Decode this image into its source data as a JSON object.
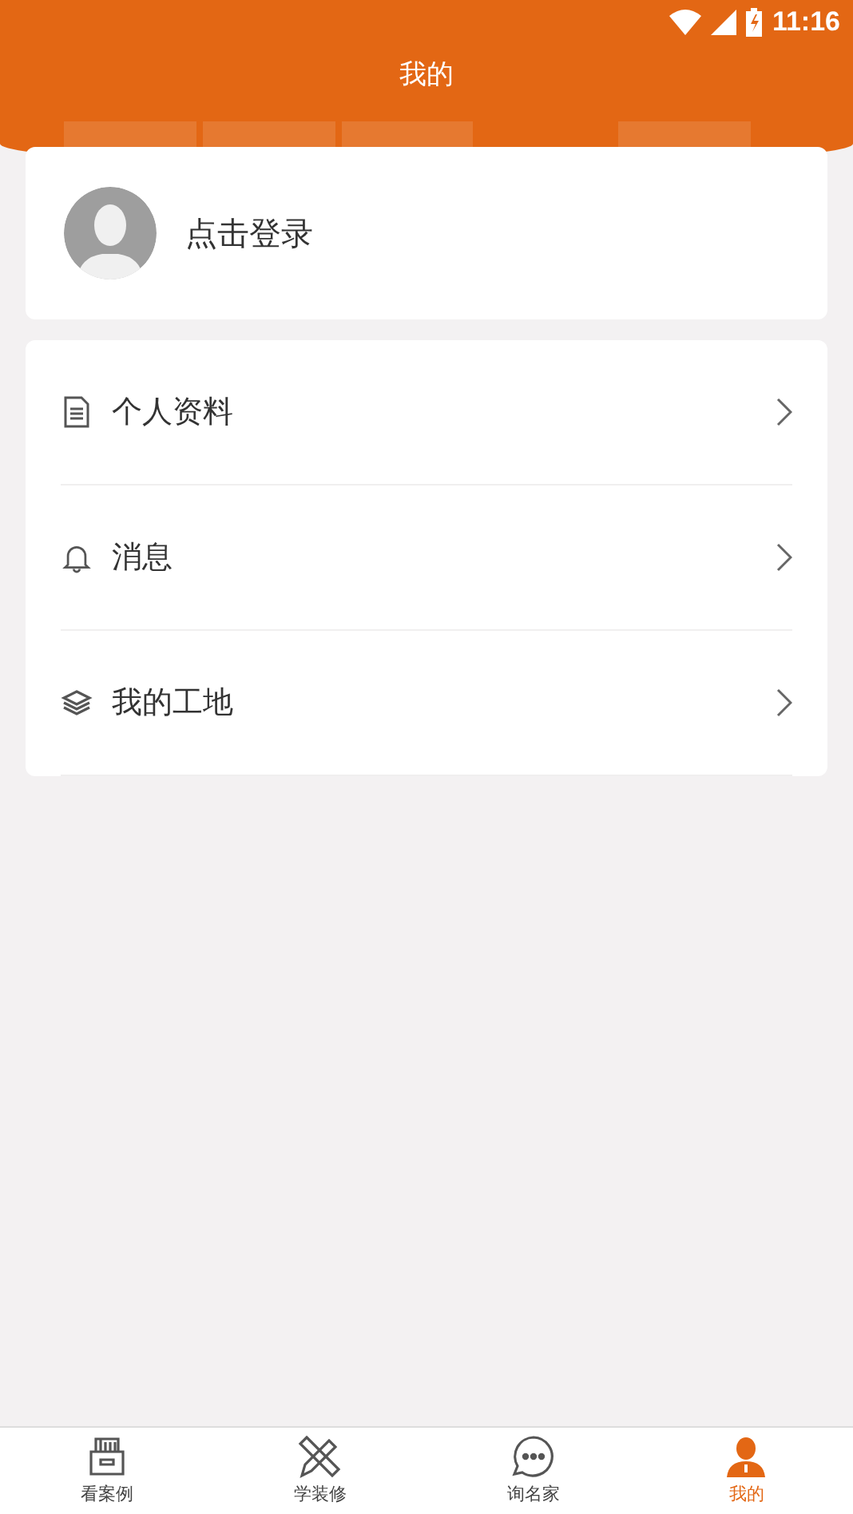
{
  "status_bar": {
    "time": "11:16"
  },
  "header": {
    "title": "我的"
  },
  "login": {
    "label": "点击登录"
  },
  "menu": [
    {
      "label": "个人资料"
    },
    {
      "label": "消息"
    },
    {
      "label": "我的工地"
    }
  ],
  "tabs": [
    {
      "label": "看案例",
      "selected": false
    },
    {
      "label": "学装修",
      "selected": false
    },
    {
      "label": "询名家",
      "selected": false
    },
    {
      "label": "我的",
      "selected": true
    }
  ]
}
